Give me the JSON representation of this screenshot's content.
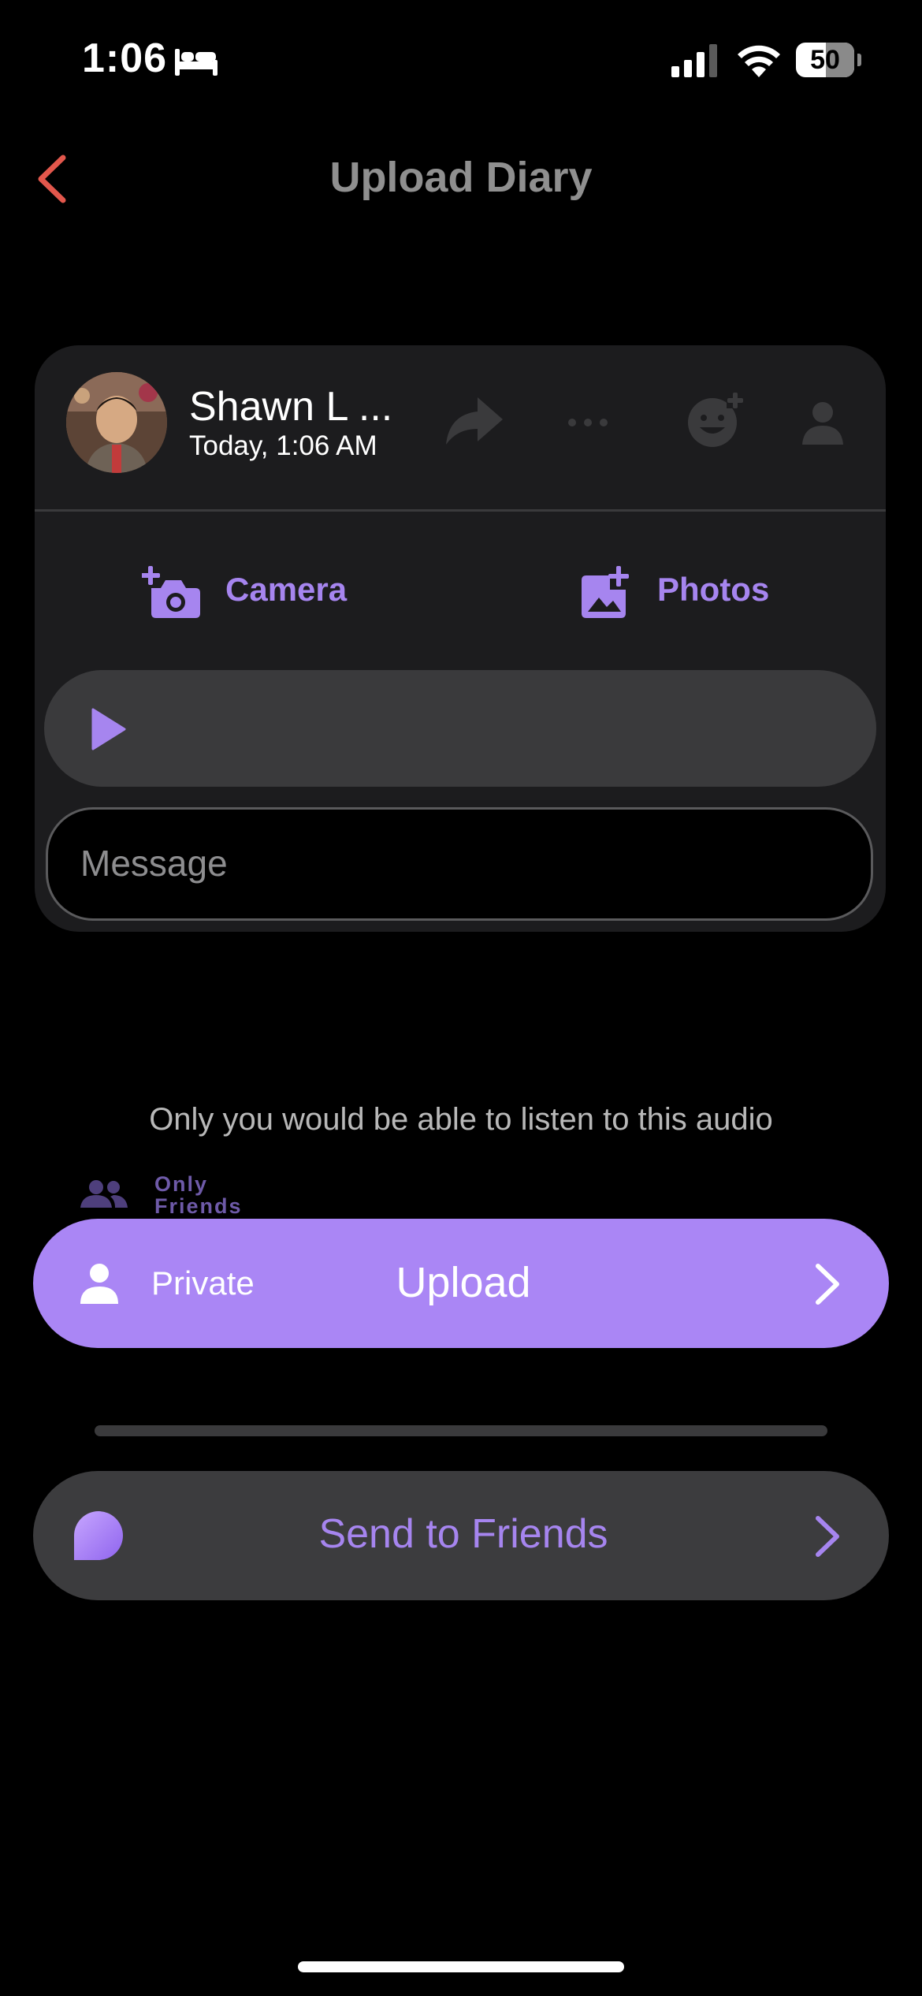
{
  "status_bar": {
    "time": "1:06",
    "battery": "50"
  },
  "header": {
    "title": "Upload Diary"
  },
  "card": {
    "user_name": "Shawn L ...",
    "date": "Today, 1:06 AM",
    "camera_label": "Camera",
    "photos_label": "Photos",
    "message_placeholder": "Message"
  },
  "audio_note": "Only you would be able to listen to this audio",
  "privacy_picker": {
    "friends_line1": "Only",
    "friends_line2": "Friends"
  },
  "upload_bar": {
    "privacy_label": "Private",
    "action_label": "Upload"
  },
  "friends_bar": {
    "label": "Send to Friends"
  },
  "colors": {
    "accent": "#aa86f5",
    "accent_text": "#a685ef",
    "back": "#e2574c",
    "card": "#1c1c1e"
  }
}
